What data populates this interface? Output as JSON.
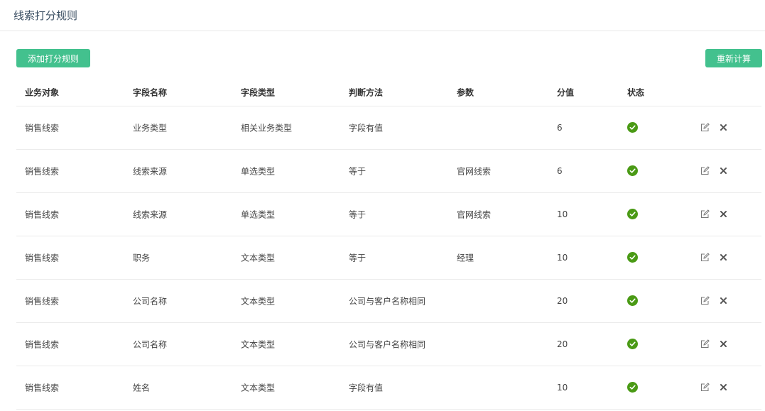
{
  "header": {
    "title": "线索打分规则"
  },
  "toolbar": {
    "add_label": "添加打分规则",
    "recalc_label": "重新计算"
  },
  "table": {
    "columns": [
      "业务对象",
      "字段名称",
      "字段类型",
      "判断方法",
      "参数",
      "分值",
      "状态"
    ],
    "rows": [
      [
        "销售线索",
        "业务类型",
        "相关业务类型",
        "字段有值",
        "",
        "6"
      ],
      [
        "销售线索",
        "线索来源",
        "单选类型",
        "等于",
        "官网线索",
        "6"
      ],
      [
        "销售线索",
        "线索来源",
        "单选类型",
        "等于",
        "官网线索",
        "10"
      ],
      [
        "销售线索",
        "职务",
        "文本类型",
        "等于",
        "经理",
        "10"
      ],
      [
        "销售线索",
        "公司名称",
        "文本类型",
        "公司与客户名称相同",
        "",
        "20"
      ],
      [
        "销售线索",
        "公司名称",
        "文本类型",
        "公司与客户名称相同",
        "",
        "20"
      ],
      [
        "销售线索",
        "姓名",
        "文本类型",
        "字段有值",
        "",
        "10"
      ]
    ],
    "row_status_icon": "check-circle-icon",
    "row_actions": [
      "edit-icon",
      "delete-icon"
    ]
  },
  "colors": {
    "accent": "#43c18e",
    "status_ok": "#4a9a15"
  }
}
